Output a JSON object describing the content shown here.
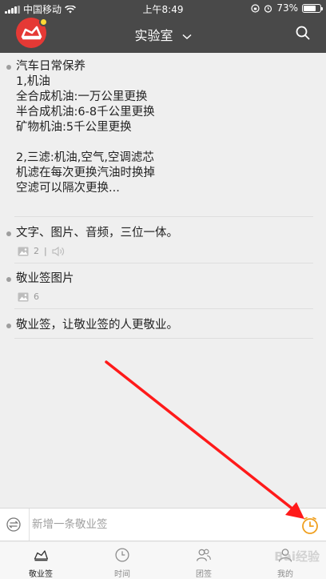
{
  "status_bar": {
    "carrier": "中国移动",
    "time": "上午8:49",
    "battery": "73%",
    "battery_level": 0.73
  },
  "header": {
    "title": "实验室",
    "icons": [
      "app-logo",
      "chevron-down-icon",
      "search-icon"
    ]
  },
  "notes": [
    {
      "text": "汽车日常保养\n1,机油\n全合成机油:一万公里更换\n半合成机油:6-8千公里更换\n矿物机油:5千公里更换\n\n2,三滤:机油,空气,空调滤芯\n机滤在每次更换汽油时换掉\n空滤可以隔次更换...",
      "meta": null
    },
    {
      "text": "文字、图片、音频，三位一体。",
      "meta": {
        "image_count": "2",
        "separator": "|",
        "icons": [
          "image-icon",
          "audio-icon"
        ]
      }
    },
    {
      "text": "敬业签图片",
      "meta": {
        "image_count": "6",
        "icons": [
          "image-icon"
        ]
      }
    },
    {
      "text": "敬业签，让敬业签的人更敬业。",
      "meta": null
    }
  ],
  "input_bar": {
    "placeholder": "新增一条敬业签",
    "icons": [
      "refresh-icon",
      "clock-icon"
    ]
  },
  "tabs": [
    {
      "label": "敬业签",
      "icon": "notes-icon",
      "active": true
    },
    {
      "label": "时间",
      "icon": "clock-icon",
      "active": false
    },
    {
      "label": "团签",
      "icon": "group-icon",
      "active": false
    },
    {
      "label": "我的",
      "icon": "person-icon",
      "active": false
    }
  ],
  "watermark": "Bai经验",
  "colors": {
    "header_bg": "#494949",
    "logo_red": "#e53935",
    "accent_orange": "#f0a020",
    "annotation_red": "#ff1a1a"
  }
}
